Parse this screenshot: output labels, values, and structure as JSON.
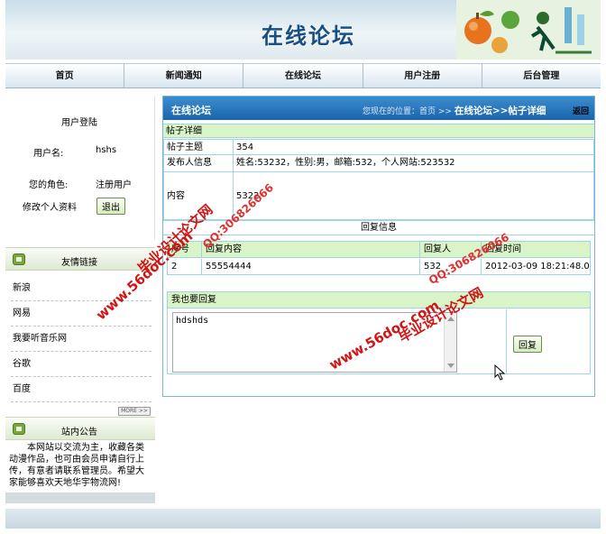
{
  "header": {
    "title": "在线论坛"
  },
  "nav": [
    "首页",
    "新闻通知",
    "在线论坛",
    "用户注册",
    "后台管理"
  ],
  "login": {
    "title": "用户登陆",
    "username_label": "用户名:",
    "username_value": "hshs",
    "role_label": "您的角色:",
    "role_value": "注册用户",
    "edit_profile": "修改个人资料",
    "logout_button": "退出"
  },
  "links": {
    "title": "友情链接",
    "items": [
      "新浪",
      "网易",
      "我要听音乐网",
      "谷歌",
      "百度"
    ],
    "more": "MORE >>"
  },
  "notice": {
    "title": "站内公告",
    "text": "本网站以交流为主，收藏各类动漫作品，也可由会员申请自行上传，有意者请联系管理员。希望大家能够喜欢天地华宇物流网!"
  },
  "main": {
    "title": "在线论坛",
    "crumb_prefix": "您现在的位置：首页 >>",
    "crumb_current": "在线论坛>>帖子详细",
    "back": "返回",
    "detail_title": "帖子详细",
    "subject_label": "帖子主题",
    "subject_value": "354",
    "author_label": "发布人信息",
    "author_value": "姓名:53232，性别:男，邮箱:532，个人网站:523532",
    "content_label": "内容",
    "content_value": "5322",
    "reply_section": "回复信息",
    "reply_headers": [
      "序号",
      "回复内容",
      "回复人",
      "回复时间"
    ],
    "reply_rows": [
      [
        "2",
        "55554444",
        "532",
        "2012-03-09 18:21:48.0"
      ]
    ],
    "form_title": "我也要回复",
    "form_text": "hdshds",
    "reply_button": "回复"
  },
  "watermarks": {
    "site": "www.56doc.com",
    "qq": "QQ:306826066",
    "name": "毕业设计论文网"
  }
}
